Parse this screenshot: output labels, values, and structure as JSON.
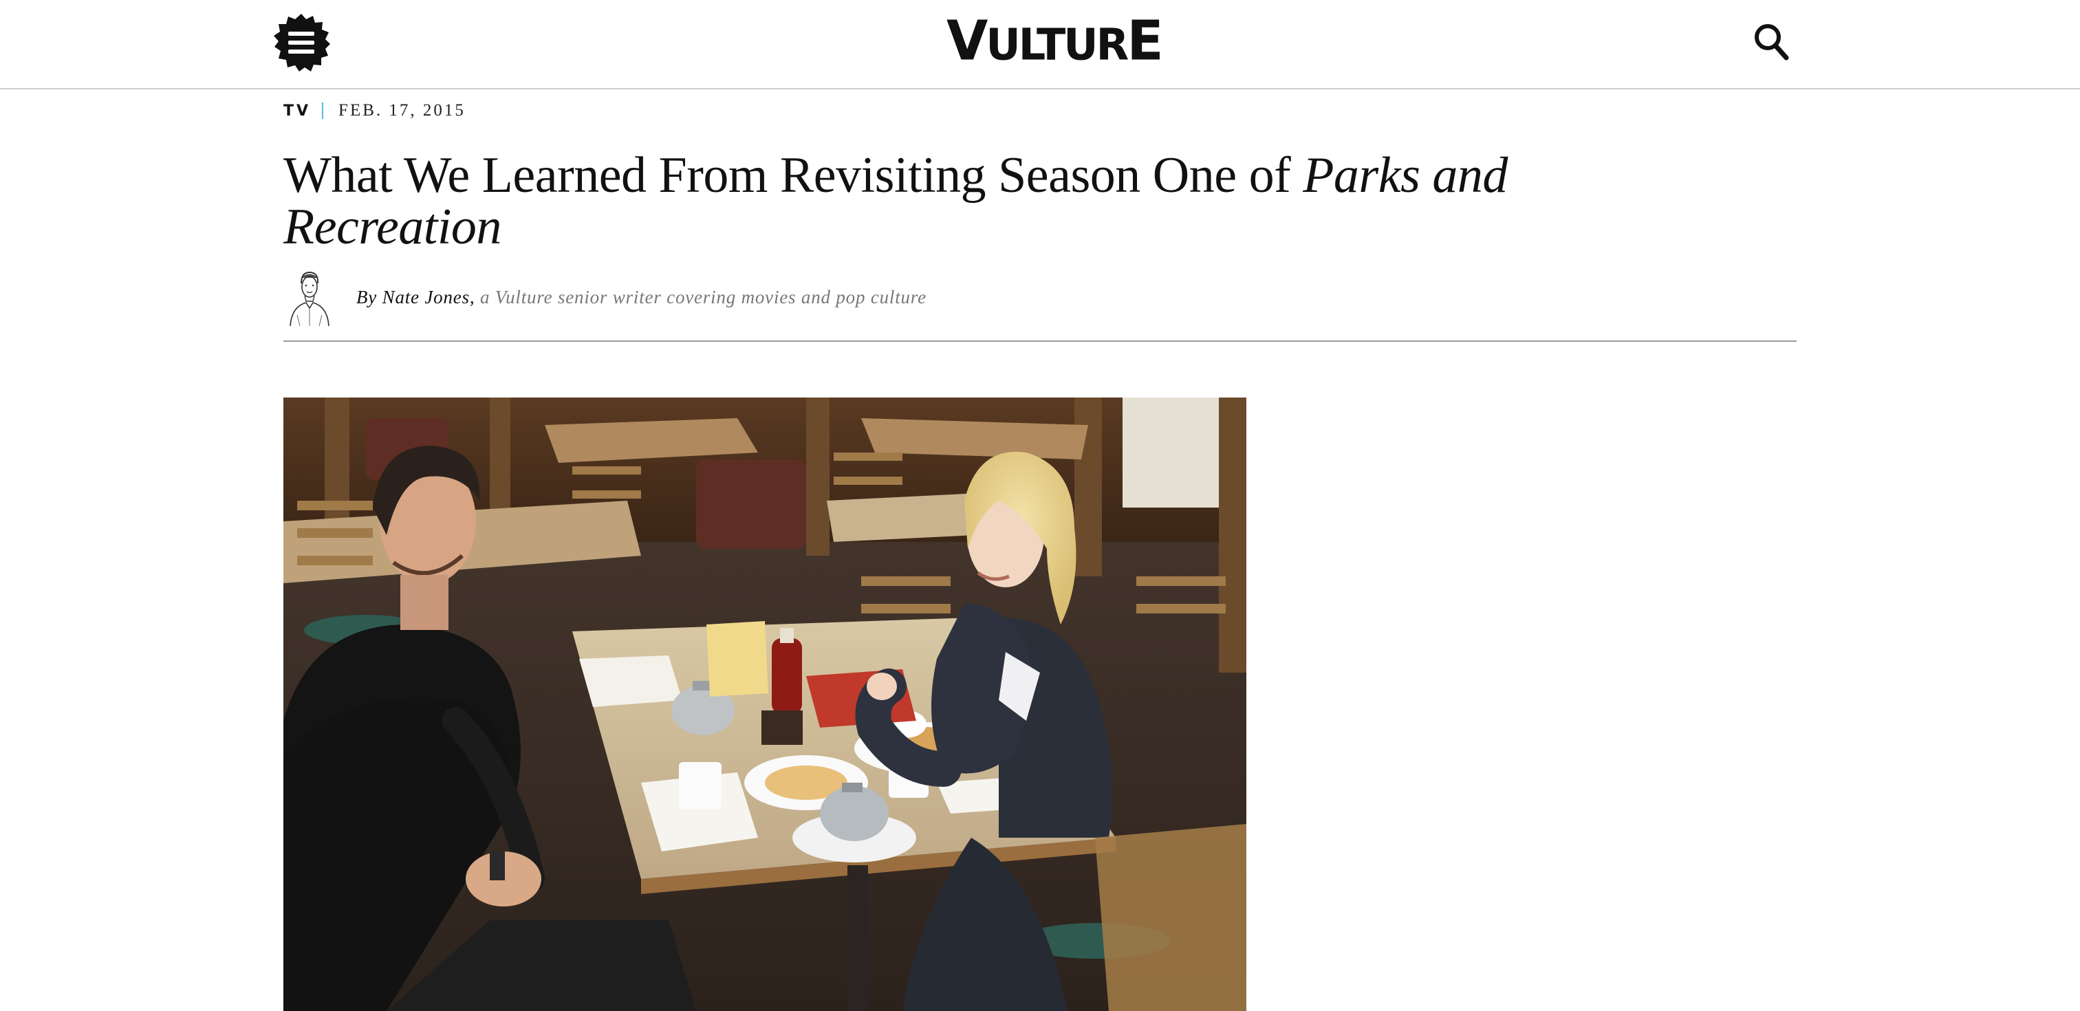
{
  "header": {
    "menu_icon": "hamburger-badge-icon",
    "logo_text_first": "V",
    "logo_text_middle": "ULTUR",
    "logo_text_last": "E",
    "search_icon": "search-icon"
  },
  "article": {
    "rubric": "TV",
    "date": "FEB. 17, 2015",
    "headline_plain": "What We Learned From Revisiting Season One of ",
    "headline_italic": "Parks and Recreation",
    "byline_prefix": "By ",
    "author": "Nate Jones",
    "byline_comma": ",",
    "author_bio": " a Vulture senior writer covering movies and pop culture"
  },
  "colors": {
    "accent_blue": "#5ab7e6",
    "text": "#111111",
    "muted": "#777777",
    "divider": "#9a9a9a"
  }
}
